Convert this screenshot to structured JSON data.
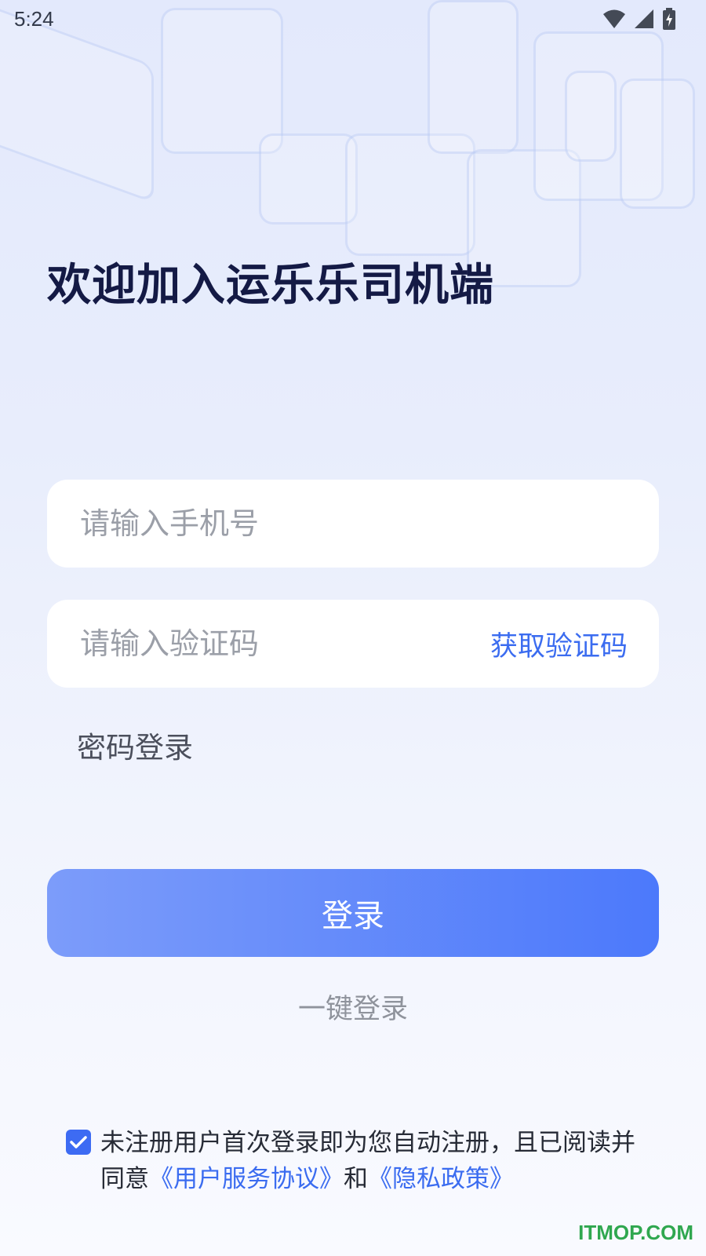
{
  "status_bar": {
    "time": "5:24"
  },
  "header": {
    "title": "欢迎加入运乐乐司机端"
  },
  "form": {
    "phone_placeholder": "请输入手机号",
    "code_placeholder": "请输入验证码",
    "get_code_label": "获取验证码",
    "password_login_label": "密码登录",
    "login_button_label": "登录",
    "one_key_login_label": "一键登录"
  },
  "agreement": {
    "checked": true,
    "text": "未注册用户首次登录即为您自动注册，且已阅读并同意",
    "service_link": "《用户服务协议》",
    "and_text": "和",
    "privacy_link": "《隐私政策》"
  },
  "watermark": "ITMOP.COM",
  "colors": {
    "accent": "#3b6cf0",
    "title": "#141a45",
    "button_start": "#7c9cfa",
    "button_end": "#4c79fb"
  },
  "icons": [
    "wifi-icon",
    "signal-icon",
    "battery-charging-icon",
    "check-icon"
  ]
}
